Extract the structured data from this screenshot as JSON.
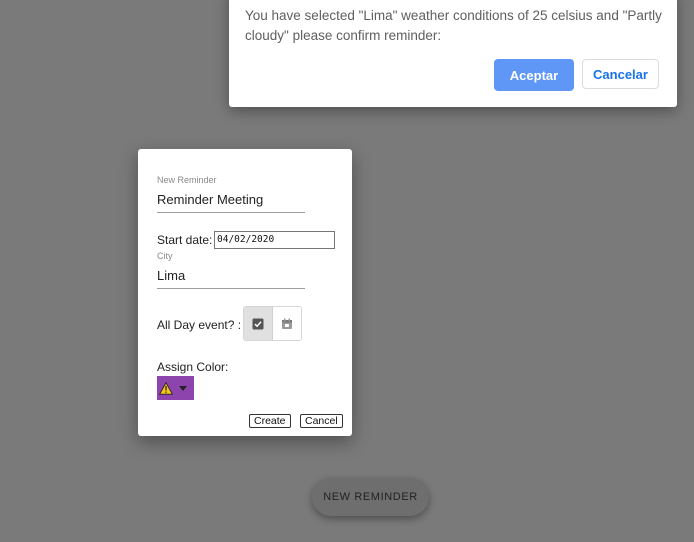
{
  "confirm_dialog": {
    "message": "You have selected \"Lima\" weather conditions of 25 celsius and \"Partly cloudy\" please confirm reminder:",
    "accept_label": "Aceptar",
    "cancel_label": "Cancelar"
  },
  "reminder_form": {
    "title_label": "New Reminder",
    "title_value": "Reminder Meeting",
    "start_date_label": "Start date:",
    "start_date_value": "04/02/2020",
    "city_label": "City",
    "city_value": "Lima",
    "all_day_label": "All Day event? :",
    "all_day_options": [
      {
        "icon": "check-box-icon",
        "selected": true
      },
      {
        "icon": "calendar-icon",
        "selected": false
      }
    ],
    "assign_color_label": "Assign Color:",
    "selected_color": "#8e44ad",
    "selected_color_icon": "warning-icon",
    "create_label": "Create",
    "cancel_label": "Cancel"
  },
  "new_reminder_button": "NEW REMINDER",
  "colors": {
    "overlay": "#7a7a7a",
    "accent": "#5e97f6",
    "link": "#1a73e8"
  }
}
